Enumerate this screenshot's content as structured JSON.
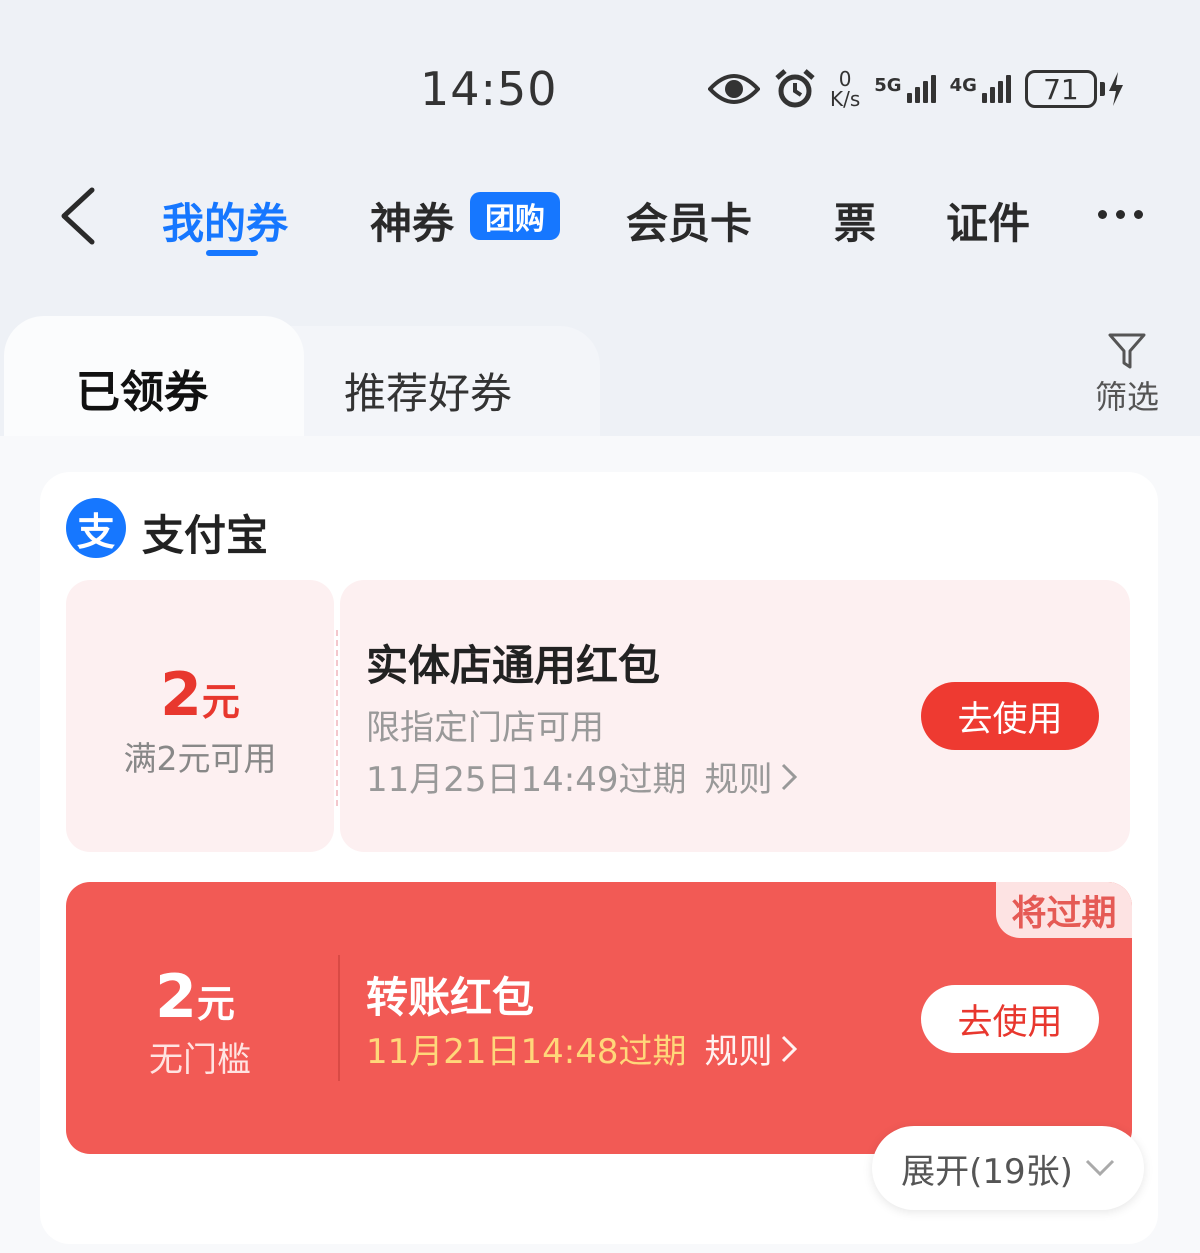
{
  "status_bar": {
    "time": "14:50",
    "net_speed_value": "0",
    "net_speed_unit": "K/s",
    "signal1_label": "5G",
    "signal2_label": "4G",
    "battery": "71"
  },
  "nav": {
    "tabs": [
      "我的券",
      "神券",
      "会员卡",
      "票",
      "证件"
    ],
    "active_tab": "我的券",
    "badge": "团购",
    "accent_color": "#1677ff"
  },
  "segments": {
    "received": "已领券",
    "recommend": "推荐好券",
    "filter": "筛选"
  },
  "group": {
    "name": "支付宝",
    "logo_glyph": "支"
  },
  "coupons": [
    {
      "amount": "2",
      "unit": "元",
      "condition": "满2元可用",
      "title": "实体店通用红包",
      "subtitle": "限指定门店可用",
      "expiry": "11月25日14:49过期",
      "rule": "规则",
      "button": "去使用"
    },
    {
      "amount": "2",
      "unit": "元",
      "condition": "无门槛",
      "title": "转账红包",
      "expiry": "11月21日14:48过期",
      "rule": "规则",
      "button": "去使用",
      "badge": "将过期"
    }
  ],
  "expand": "展开(19张)"
}
